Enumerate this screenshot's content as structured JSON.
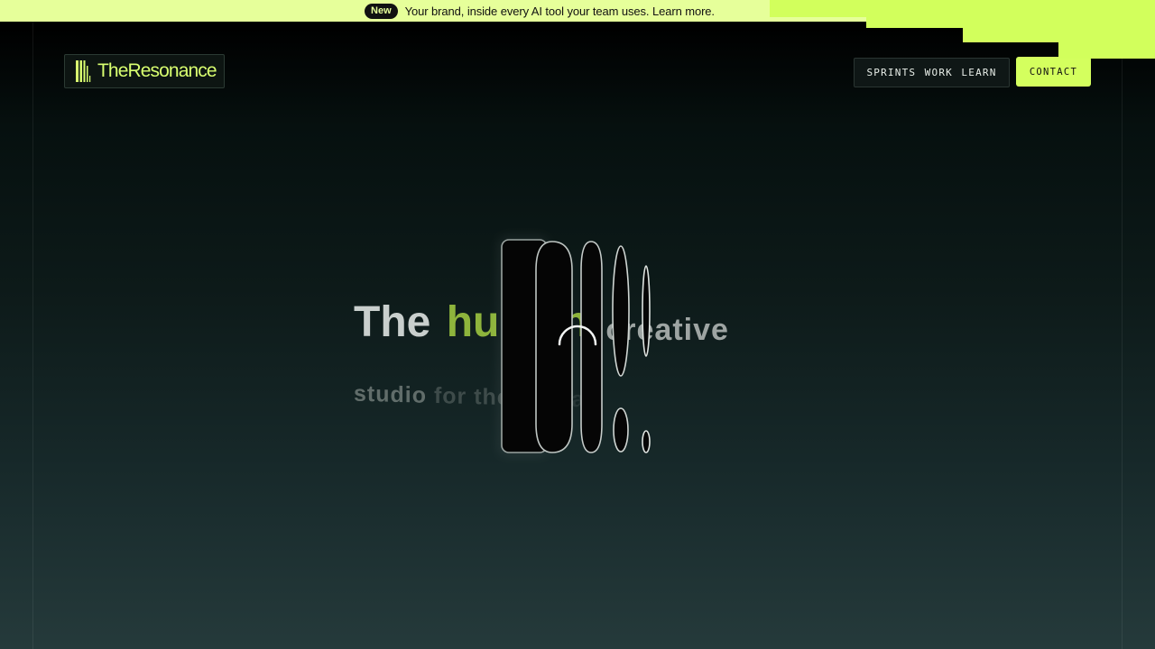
{
  "announcement": {
    "badge": "New",
    "text": "Your brand, inside every AI tool your team uses. Learn more."
  },
  "brand": {
    "name": "TheResonance",
    "logo_icon": "barcode-logo-icon"
  },
  "nav": {
    "items": [
      {
        "label": "SPRINTS"
      },
      {
        "label": "WORK"
      },
      {
        "label": "LEARN"
      }
    ],
    "contact_label": "CONTACT"
  },
  "hero": {
    "word_the": "The",
    "word_human": "human",
    "word_creative": "creative",
    "line2_start": "studio ",
    "line2_mid": "for the ",
    "line2_end": "AI era"
  },
  "colors": {
    "accent": "#d4ff5e",
    "announcement_bg": "#e6ff9a",
    "human_word": "#8eb43c"
  }
}
